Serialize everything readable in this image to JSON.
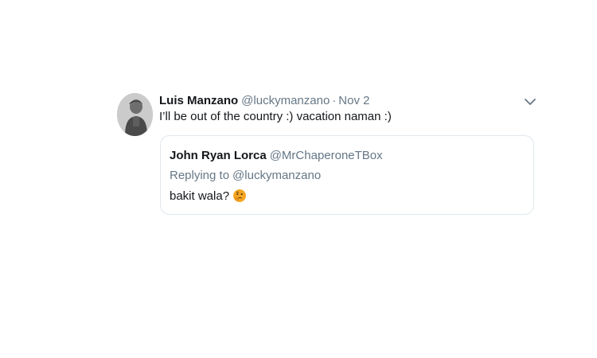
{
  "tweet": {
    "author_name": "Luis Manzano",
    "author_handle": "@luckymanzano",
    "separator": "·",
    "date": "Nov 2",
    "text": "I’ll be out of the country :) vacation naman :)",
    "avatar_icon": "avatar-photo",
    "menu_icon": "chevron-down-icon"
  },
  "quoted_tweet": {
    "author_name": "John Ryan Lorca",
    "author_handle": "@MrChaperoneTBox",
    "replying_prefix": "Replying to",
    "replying_to": "@luckymanzano",
    "text": "bakit wala?",
    "emoji": "thinking-face-emoji"
  },
  "colors": {
    "text_primary": "#14171a",
    "text_secondary": "#657786",
    "border": "#e1e8ed",
    "emoji": "#f5a623"
  }
}
